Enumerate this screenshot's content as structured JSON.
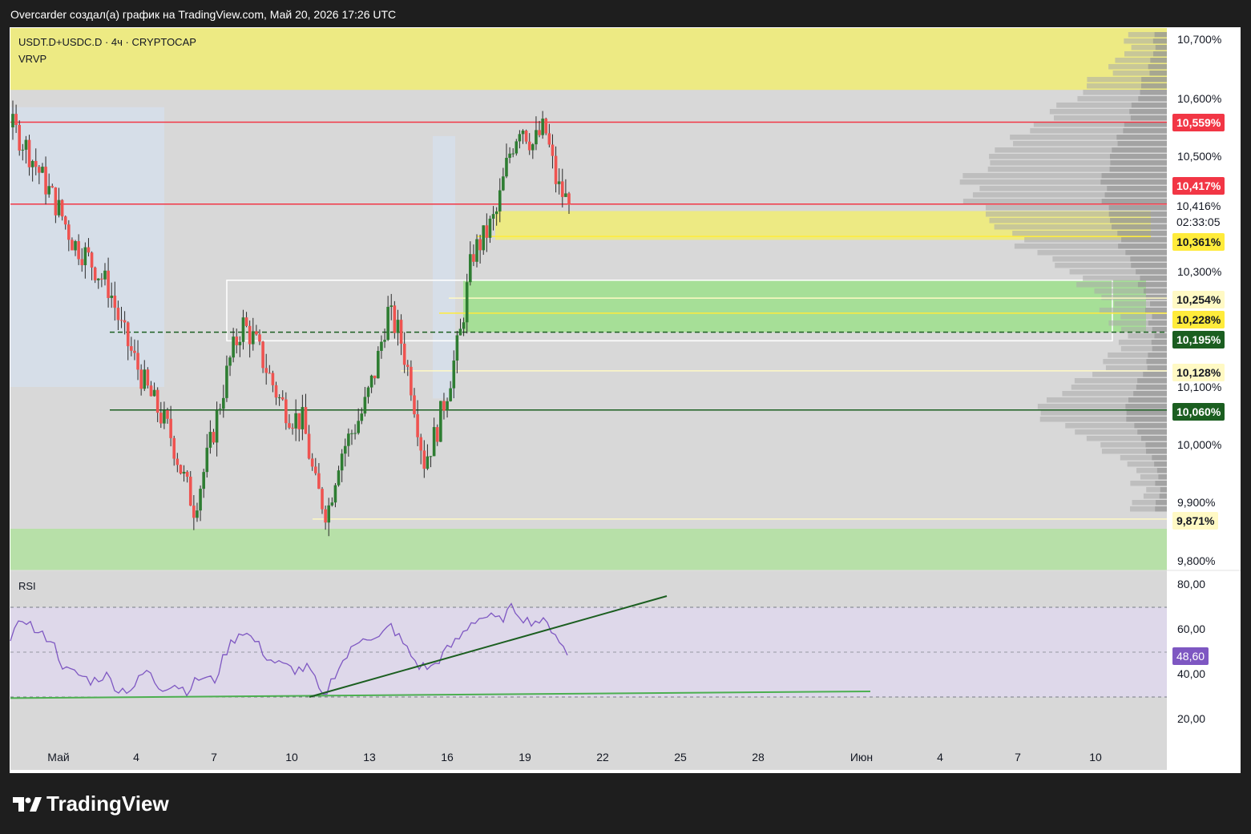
{
  "header": {
    "attribution": "Overcarder создал(а) график на TradingView.com, Май 20, 2026 17:26 UTC"
  },
  "symbol": {
    "title": "USDT.D+USDC.D · 4ч · CRYPTOCAP",
    "indicator": "VRVP"
  },
  "rsi": {
    "title": "RSI",
    "current_label": "48,60",
    "color": "#7e57c2"
  },
  "brand": {
    "logo_text": "TradingView"
  },
  "price_axis": [
    "10,700%",
    "10,600%",
    "10,500%",
    "10,300%",
    "10,100%",
    "10,000%",
    "9,900%",
    "9,800%"
  ],
  "price_tags": [
    {
      "text": "10,559%",
      "bg": "#f23645",
      "fg": "#ffffff"
    },
    {
      "text": "10,417%",
      "bg": "#f23645",
      "fg": "#ffffff"
    },
    {
      "text": "10,416%",
      "bg": "#ffffff",
      "fg": "#131722"
    },
    {
      "text": "02:33:05",
      "bg": "#ffffff",
      "fg": "#131722"
    },
    {
      "text": "10,361%",
      "bg": "#ffeb3b",
      "fg": "#131722"
    },
    {
      "text": "10,254%",
      "bg": "#fff9c4",
      "fg": "#131722"
    },
    {
      "text": "10,228%",
      "bg": "#ffeb3b",
      "fg": "#131722"
    },
    {
      "text": "10,195%",
      "bg": "#1b5e20",
      "fg": "#ffffff"
    },
    {
      "text": "10,128%",
      "bg": "#fff9c4",
      "fg": "#131722"
    },
    {
      "text": "10,060%",
      "bg": "#1b5e20",
      "fg": "#ffffff"
    },
    {
      "text": "9,871%",
      "bg": "#fff9c4",
      "fg": "#131722"
    }
  ],
  "rsi_axis": [
    "80,00",
    "60,00",
    "40,00",
    "20,00"
  ],
  "time_axis": [
    "Май",
    "4",
    "7",
    "10",
    "13",
    "16",
    "19",
    "22",
    "25",
    "28",
    "Июн",
    "4",
    "7",
    "10"
  ],
  "colors": {
    "up": "#2e7d32",
    "down": "#ef5350",
    "resistance": "#f23645",
    "support": "#1b5e20",
    "supply_zone": "#f0ec7a",
    "demand_zone": "#9de08c",
    "rsi_band": "#ded8ea"
  },
  "chart_data": [
    {
      "type": "candlestick",
      "title": "USDT.D+USDC.D · 4ч · CRYPTOCAP",
      "ylabel": "%",
      "ylim": [
        9.77,
        10.72
      ],
      "x_ticks": [
        "Май",
        "4",
        "7",
        "10",
        "13",
        "16",
        "19",
        "22",
        "25",
        "28",
        "Июн",
        "4",
        "7",
        "10"
      ],
      "close_path": [
        10.55,
        10.52,
        10.48,
        10.44,
        10.4,
        10.35,
        10.33,
        10.3,
        10.27,
        10.2,
        10.15,
        10.1,
        10.06,
        10.02,
        9.95,
        9.89,
        9.97,
        10.06,
        10.15,
        10.21,
        10.18,
        10.13,
        10.08,
        10.05,
        10.04,
        9.93,
        9.88,
        9.98,
        10.02,
        10.06,
        10.13,
        10.23,
        10.19,
        10.1,
        9.97,
        10.02,
        10.1,
        10.19,
        10.33,
        10.36,
        10.4,
        10.5,
        10.56,
        10.52,
        10.55,
        10.45,
        10.416
      ],
      "current_price": 10.416,
      "countdown": "02:33:05",
      "levels": [
        {
          "value": 10.559,
          "kind": "resistance"
        },
        {
          "value": 10.417,
          "kind": "resistance"
        },
        {
          "value": 10.361,
          "kind": "supply-zone"
        },
        {
          "value": 10.254,
          "kind": "level"
        },
        {
          "value": 10.228,
          "kind": "level"
        },
        {
          "value": 10.195,
          "kind": "dashed-support"
        },
        {
          "value": 10.128,
          "kind": "level"
        },
        {
          "value": 10.06,
          "kind": "support"
        },
        {
          "value": 9.871,
          "kind": "level"
        }
      ],
      "zones": [
        {
          "kind": "supply",
          "from": 10.615,
          "to": 10.72
        },
        {
          "kind": "supply",
          "from": 10.355,
          "to": 10.405
        },
        {
          "kind": "demand",
          "from": 10.195,
          "to": 10.285
        },
        {
          "kind": "demand",
          "from": 9.77,
          "to": 9.845
        }
      ],
      "volume_profile": "VRVP"
    },
    {
      "type": "line",
      "title": "RSI",
      "ylim": [
        10,
        85
      ],
      "bands": [
        30,
        70
      ],
      "midline": 50,
      "values": [
        55,
        66,
        58,
        56,
        42,
        40,
        37,
        40,
        33,
        34,
        42,
        34,
        36,
        33,
        39,
        37,
        52,
        60,
        55,
        47,
        44,
        42,
        43,
        29,
        42,
        50,
        58,
        55,
        62,
        53,
        44,
        43,
        50,
        56,
        64,
        66,
        64,
        70,
        64,
        64,
        60,
        48.6
      ],
      "current": 48.6
    }
  ]
}
